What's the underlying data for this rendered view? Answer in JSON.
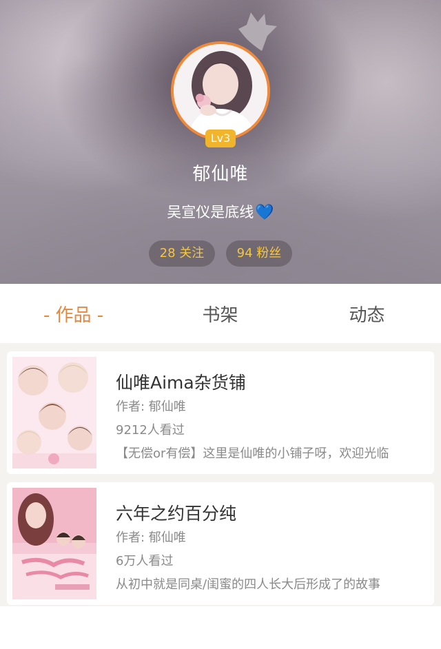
{
  "profile": {
    "level": "Lv3",
    "name": "郁仙唯",
    "bio": "吴宣仪是底线",
    "bio_emoji": "💙",
    "follow": "28 关注",
    "fans": "94 粉丝"
  },
  "tabs": {
    "works": "- 作品 -",
    "bookshelf": "书架",
    "activity": "动态"
  },
  "books": [
    {
      "title": "仙唯Aima杂货铺",
      "author": "作者: 郁仙唯",
      "views": "9212人看过",
      "desc": "【无偿or有偿】这里是仙唯的小铺子呀，欢迎光临"
    },
    {
      "title": "六年之约百分纯",
      "author": "作者: 郁仙唯",
      "views": "6万人看过",
      "desc": "从初中就是同桌/闺蜜的四人长大后形成了的故事"
    }
  ],
  "colors": {
    "accent": "#e8873e",
    "level_badge": "#f2b42b",
    "stat_text": "#f6c73e",
    "heart": "#2a8ae8"
  }
}
